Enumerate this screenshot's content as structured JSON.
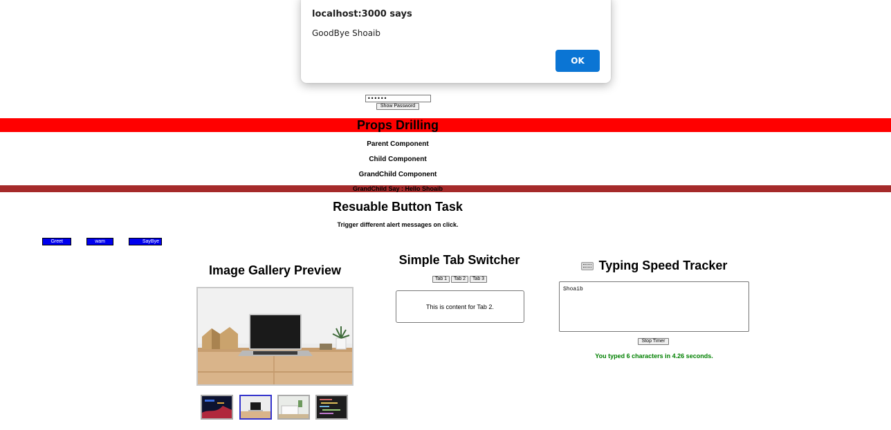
{
  "password": {
    "value": "••••••",
    "show_button": "Show Password"
  },
  "props_drilling": {
    "title": "Props Drilling",
    "parent": "Parent Component",
    "child": "Child Component",
    "grandchild": "GrandChild Component",
    "grandchild_say": "GrandChild Say : Hello Shoaib",
    "title_band_color": "#ff0000",
    "say_band_color": "#a52a2a"
  },
  "button_task": {
    "title": "Resuable Button Task",
    "subtitle": "Trigger different alert messages on click.",
    "buttons": [
      "Greet",
      "wam",
      "SayBye"
    ],
    "button_color": "#0000ee"
  },
  "gallery": {
    "title": "Image Gallery Preview",
    "thumbnails": [
      "thumb-1",
      "thumb-2",
      "thumb-3",
      "thumb-4"
    ],
    "active_index": 1
  },
  "tabs": {
    "title": "Simple Tab Switcher",
    "tab_labels": [
      "Tab 1",
      "Tab 2",
      "Tab 3"
    ],
    "content": "This is content for Tab 2."
  },
  "typing": {
    "title": "Typing Speed Tracker",
    "icon": "keyboard-icon",
    "text": "Shoaib",
    "stop_button": "Stop Timer",
    "result": "You typed 6 characters in 4.26 seconds.",
    "result_color": "#008000"
  },
  "alert": {
    "title": "localhost:3000 says",
    "message": "GoodBye Shoaib",
    "ok": "OK",
    "ok_color": "#0b75d4"
  }
}
